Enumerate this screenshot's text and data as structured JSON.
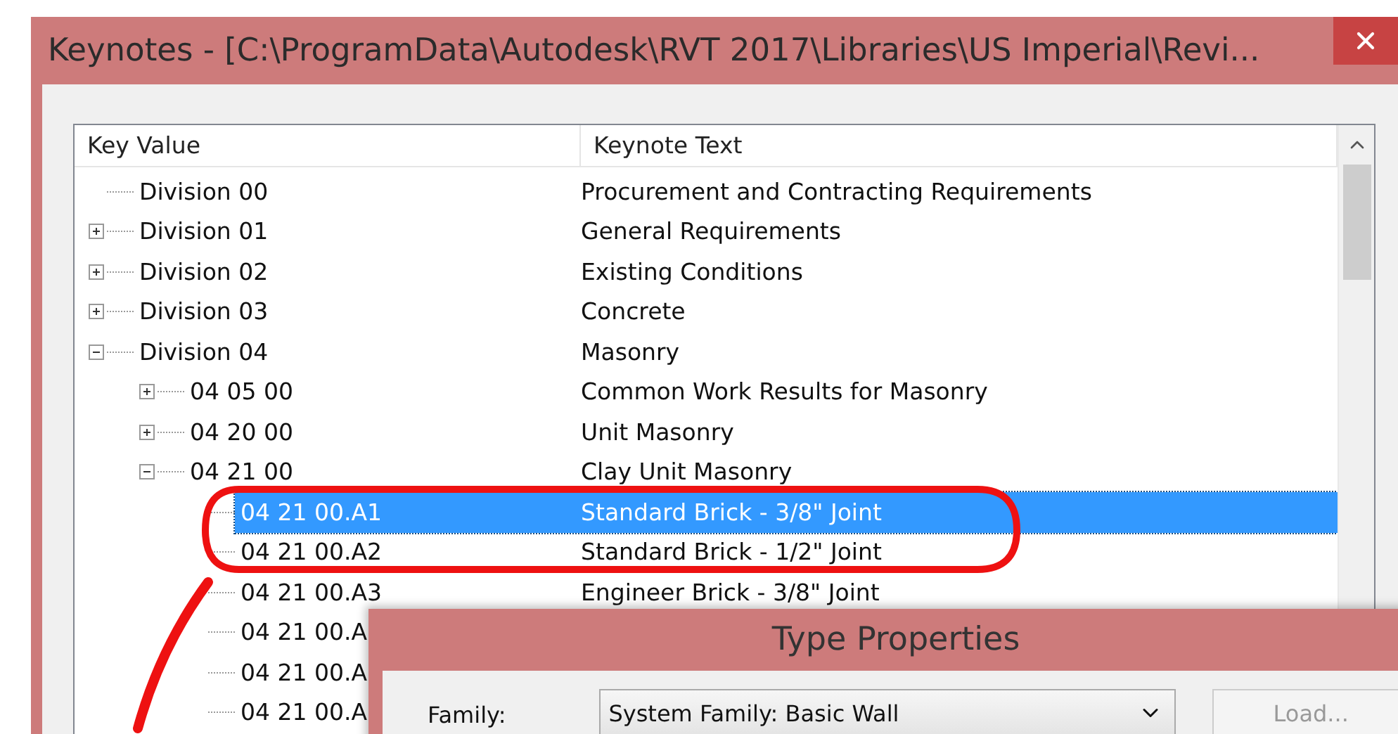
{
  "window": {
    "title": "Keynotes - [C:\\ProgramData\\Autodesk\\RVT 2017\\Libraries\\US Imperial\\Revi..."
  },
  "table": {
    "columns": [
      "Key Value",
      "Keynote Text"
    ],
    "rows": [
      {
        "key": "Division 00",
        "text": "Procurement and Contracting Requirements",
        "selected": false
      },
      {
        "key": "Division 01",
        "text": "General Requirements",
        "expanded": false,
        "selected": false
      },
      {
        "key": "Division 02",
        "text": "Existing Conditions",
        "expanded": false,
        "selected": false
      },
      {
        "key": "Division 03",
        "text": "Concrete",
        "expanded": false,
        "selected": false
      },
      {
        "key": "Division 04",
        "text": "Masonry",
        "expanded": true,
        "selected": false,
        "children": [
          {
            "key": "04 05 00",
            "text": "Common Work Results for Masonry",
            "expanded": false,
            "selected": false
          },
          {
            "key": "04 20 00",
            "text": "Unit Masonry",
            "expanded": false,
            "selected": false
          },
          {
            "key": "04 21 00",
            "text": "Clay Unit Masonry",
            "expanded": true,
            "selected": false,
            "children": [
              {
                "key": "04 21 00.A1",
                "text": "Standard Brick - 3/8\" Joint",
                "selected": true
              },
              {
                "key": "04 21 00.A2",
                "text": "Standard Brick - 1/2\" Joint",
                "selected": false
              },
              {
                "key": "04 21 00.A3",
                "text": "Engineer Brick - 3/8\" Joint",
                "selected": false
              },
              {
                "key": "04 21 00.A",
                "selected": false
              },
              {
                "key": "04 21 00.A",
                "selected": false
              },
              {
                "key": "04 21 00.A",
                "selected": false
              }
            ]
          }
        ]
      }
    ]
  },
  "dialog": {
    "title": "Type Properties",
    "family_label": "Family:",
    "family_value": "System Family: Basic Wall",
    "load_button": {
      "label": "Load...",
      "disabled": true
    }
  }
}
